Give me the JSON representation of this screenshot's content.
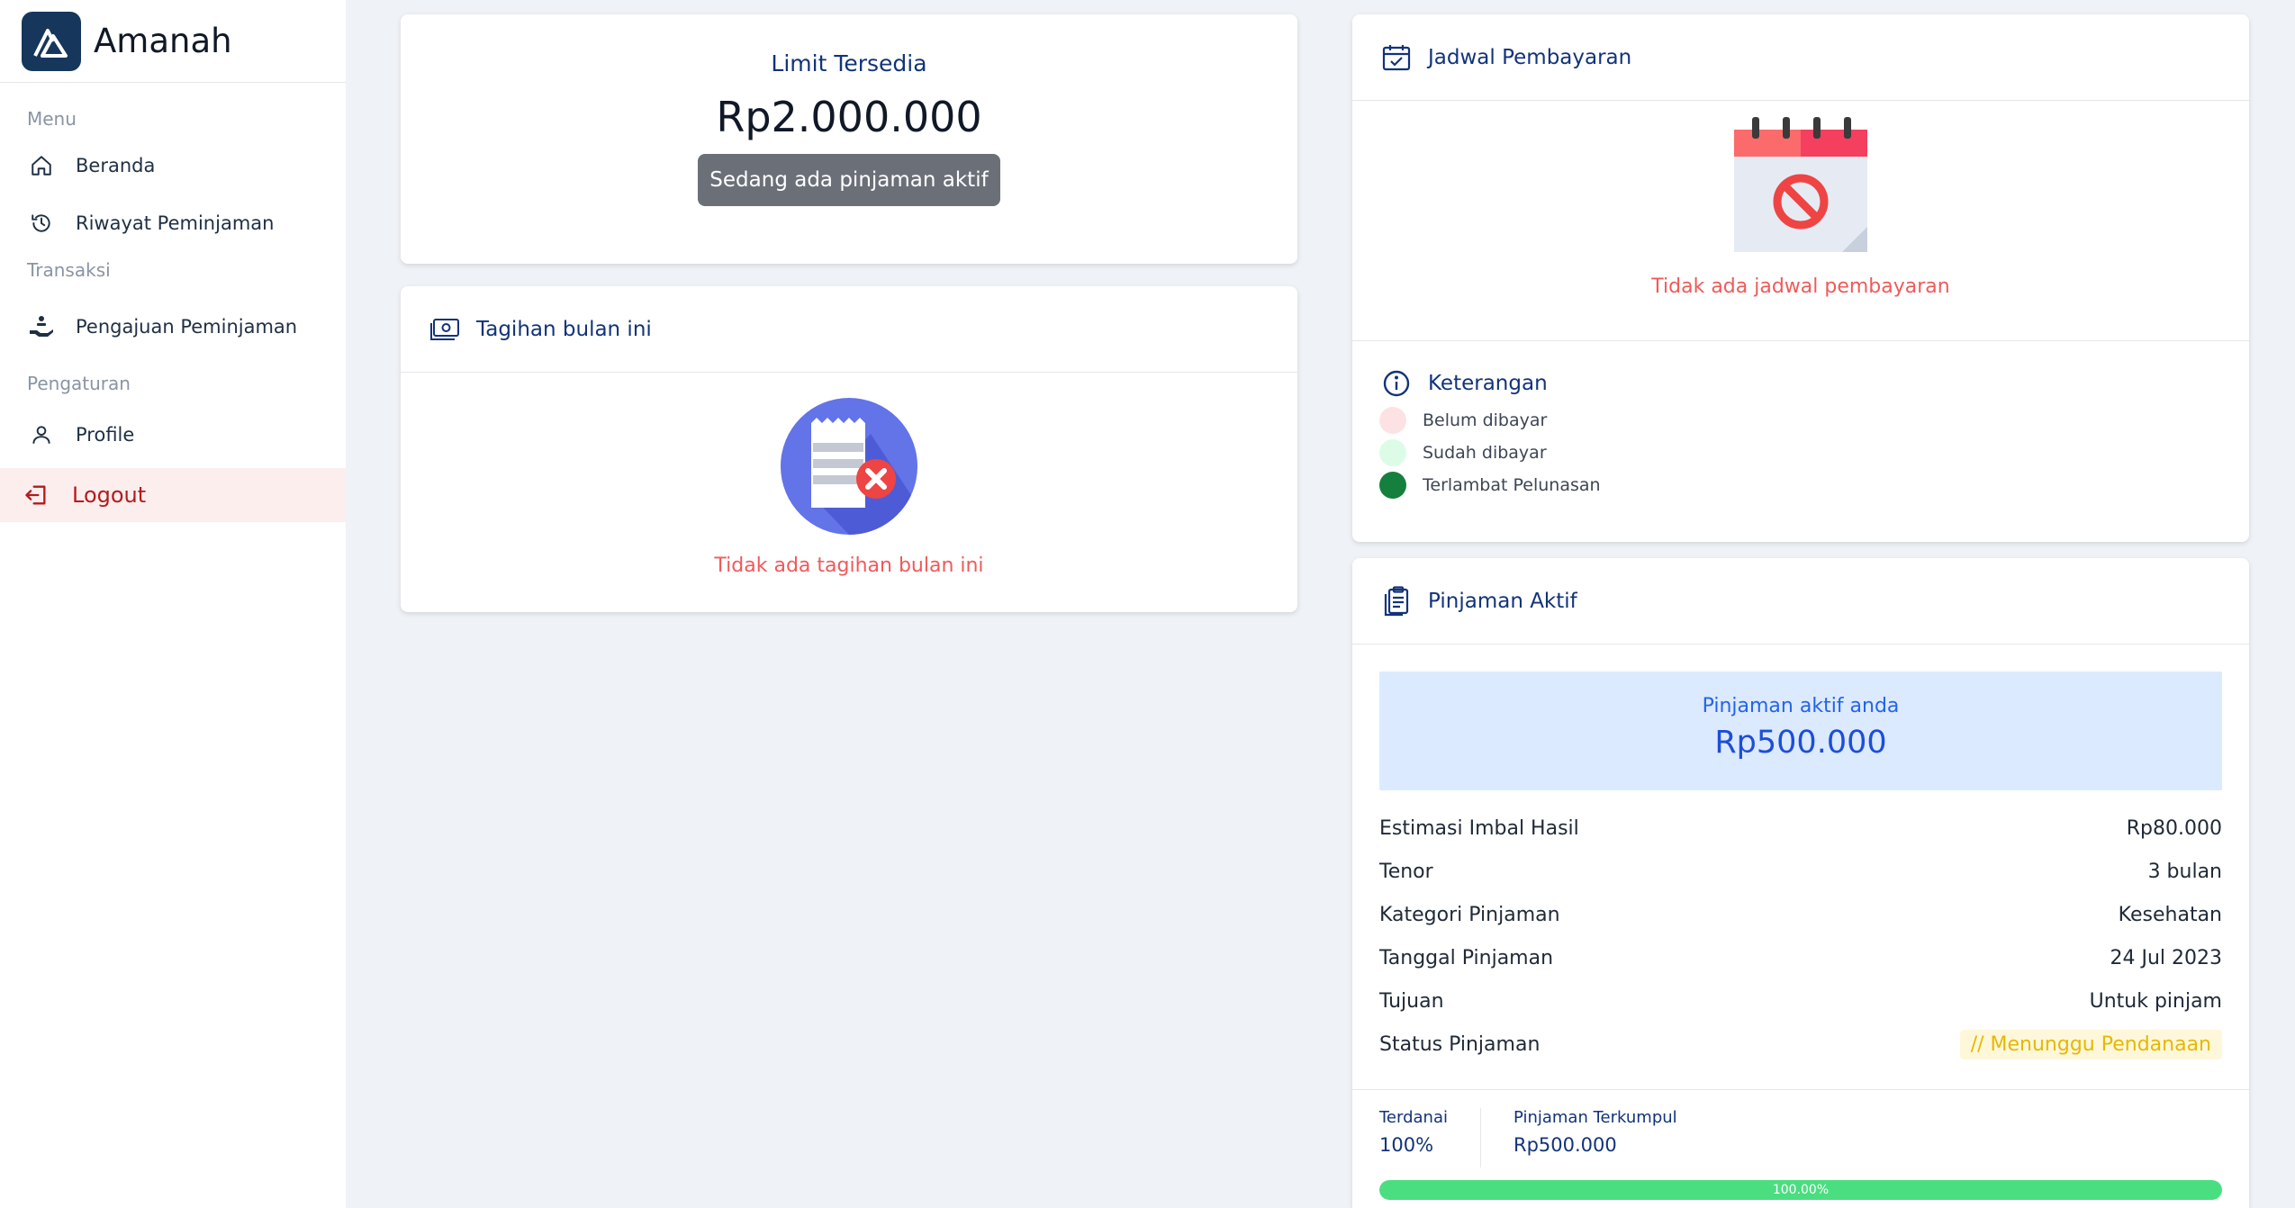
{
  "brand": {
    "name": "Amanah"
  },
  "sidebar": {
    "sections": [
      {
        "label": "Menu"
      },
      {
        "label": "Transaksi"
      },
      {
        "label": "Pengaturan"
      }
    ],
    "items": [
      {
        "label": "Beranda",
        "icon": "home-icon"
      },
      {
        "label": "Riwayat Peminjaman",
        "icon": "history-icon"
      },
      {
        "label": "Pengajuan Peminjaman",
        "icon": "loan-hand-icon"
      },
      {
        "label": "Profile",
        "icon": "user-icon"
      },
      {
        "label": "Logout",
        "icon": "logout-icon"
      }
    ]
  },
  "limit": {
    "title": "Limit Tersedia",
    "amount": "Rp2.000.000",
    "button_label": "Sedang ada pinjaman aktif"
  },
  "tagihan": {
    "title": "Tagihan bulan ini",
    "empty_text": "Tidak ada tagihan bulan ini"
  },
  "jadwal": {
    "title": "Jadwal Pembayaran",
    "empty_text": "Tidak ada jadwal pembayaran"
  },
  "keterangan": {
    "title": "Keterangan",
    "items": [
      {
        "label": "Belum dibayar",
        "color": "#fde2e4"
      },
      {
        "label": "Sudah dibayar",
        "color": "#dcfce7"
      },
      {
        "label": "Terlambat Pelunasan",
        "color": "#15803d"
      }
    ]
  },
  "pinjaman": {
    "title": "Pinjaman Aktif",
    "active_label": "Pinjaman aktif anda",
    "active_amount": "Rp500.000",
    "details": [
      {
        "label": "Estimasi Imbal Hasil",
        "value": "Rp80.000"
      },
      {
        "label": "Tenor",
        "value": "3 bulan"
      },
      {
        "label": "Kategori Pinjaman",
        "value": "Kesehatan"
      },
      {
        "label": "Tanggal Pinjaman",
        "value": "24 Jul 2023"
      },
      {
        "label": "Tujuan",
        "value": "Untuk pinjam"
      },
      {
        "label": "Status Pinjaman",
        "value": "// Menunggu Pendanaan"
      }
    ],
    "funded_label": "Terdanai",
    "funded_value": "100%",
    "collected_label": "Pinjaman Terkumpul",
    "collected_value": "Rp500.000",
    "progress": 1.0,
    "progress_text": "100.00%"
  },
  "colors": {
    "primary": "#12337a",
    "danger": "#f05a5a",
    "progress": "#4ade80",
    "logout_bg": "#fdeeee"
  }
}
